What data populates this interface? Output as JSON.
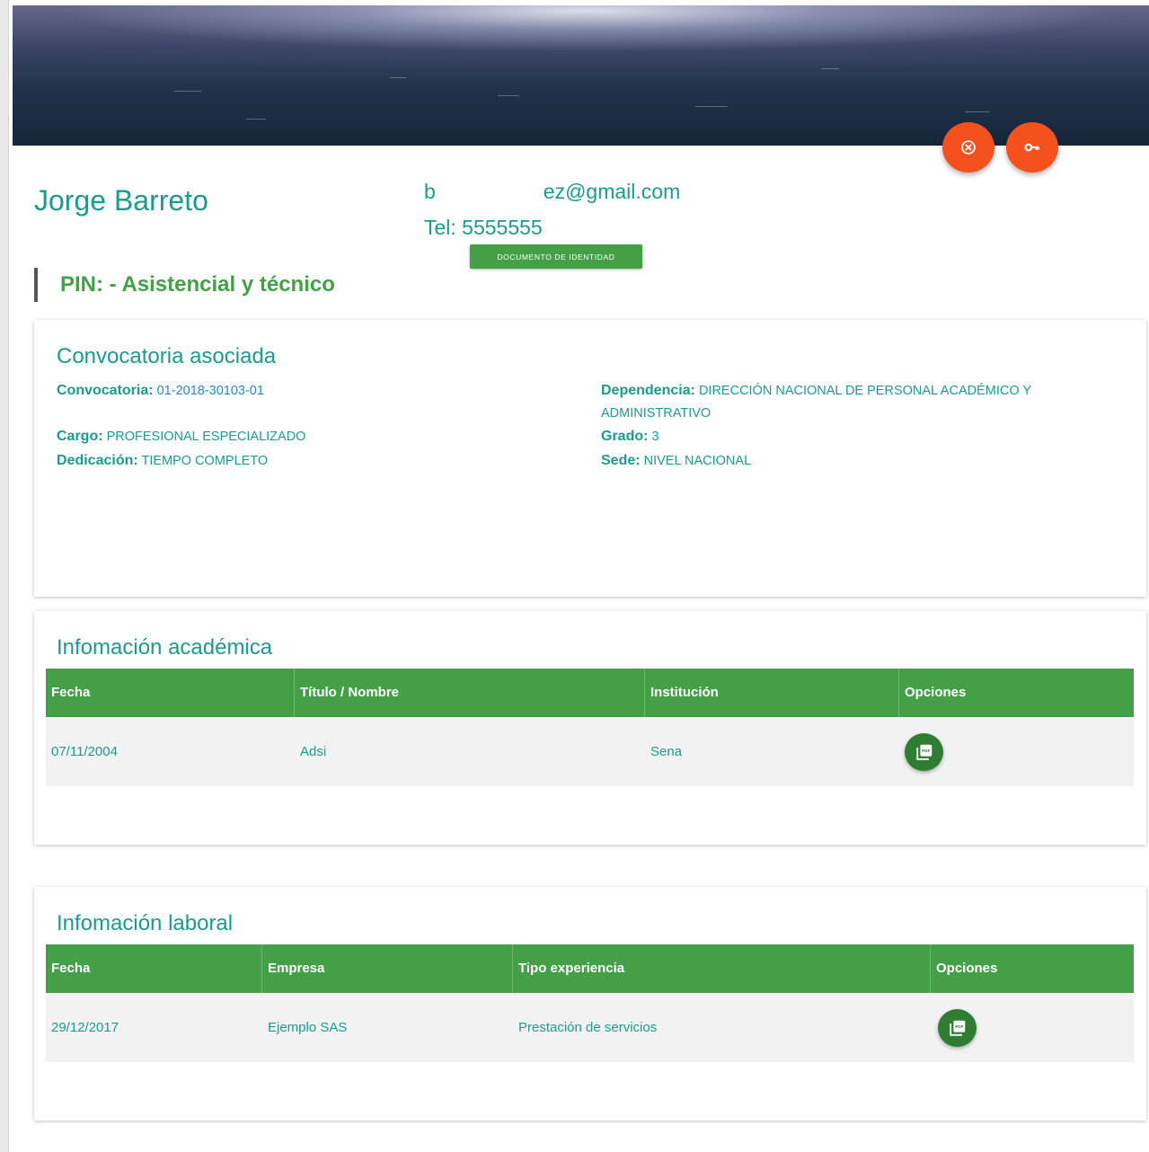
{
  "header": {
    "name": "Jorge Barreto",
    "email_start": "b",
    "email_end": "ez@gmail.com",
    "tel": "Tel: 5555555",
    "document_button": "DOCUMENTO DE IDENTIDAD",
    "actions": [
      {
        "icon": "cancel-circle-icon",
        "color": "#f4511e"
      },
      {
        "icon": "key-icon",
        "color": "#f4511e"
      }
    ]
  },
  "pin": "PIN: - Asistencial y técnico",
  "convocatoria": {
    "title": "Convocatoria asociada",
    "convocatoria_label": "Convocatoria:",
    "convocatoria_value": "01-2018-30103-01",
    "cargo_label": "Cargo:",
    "cargo_value": "PROFESIONAL ESPECIALIZADO",
    "dedicacion_label": "Dedicación:",
    "dedicacion_value": "TIEMPO COMPLETO",
    "dependencia_label": "Dependencia:",
    "dependencia_value": "DIRECCIÓN NACIONAL DE PERSONAL ACADÉMICO Y",
    "dependencia_value_2": "ADMINISTRATIVO",
    "grado_label": "Grado:",
    "grado_value": "3",
    "sede_label": "Sede:",
    "sede_value": "NIVEL NACIONAL"
  },
  "academica": {
    "title": "Infomación académica",
    "headers": [
      "Fecha",
      "Título / Nombre",
      "Institución",
      "Opciones"
    ],
    "rows": [
      {
        "fecha": "07/11/2004",
        "titulo": "Adsi",
        "institucion": "Sena",
        "option_icon": "pdf-icon"
      }
    ]
  },
  "laboral": {
    "title": "Infomación laboral",
    "headers": [
      "Fecha",
      "Empresa",
      "Tipo experiencia",
      "Opciones"
    ],
    "rows": [
      {
        "fecha": "29/12/2017",
        "empresa": "Ejemplo SAS",
        "tipo": "Prestación de servicios",
        "option_icon": "pdf-icon"
      }
    ]
  },
  "colors": {
    "primary_green": "#43a047",
    "teal_text": "#1a9c8c",
    "fab_orange": "#f4511e",
    "pdf_button": "#2e7d32",
    "row_bg": "#f2f2f2"
  }
}
